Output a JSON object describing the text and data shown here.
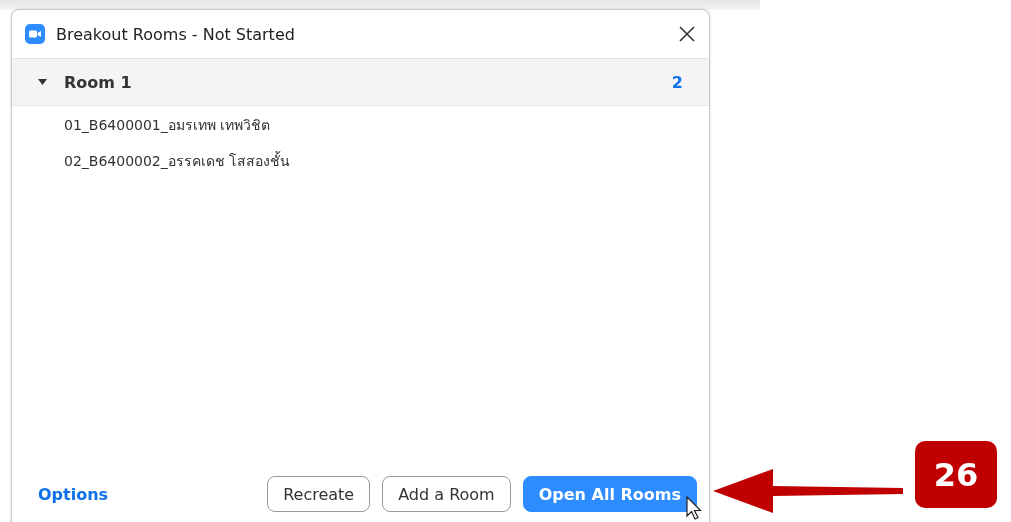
{
  "window": {
    "title": "Breakout Rooms - Not Started"
  },
  "rooms": [
    {
      "name": "Room 1",
      "count": "2",
      "expanded": true,
      "members": [
        "01_B6400001_อมรเทพ เทพวิชิต",
        "02_B6400002_อรรคเดช โสสองชั้น"
      ]
    }
  ],
  "footer": {
    "options_link": "Options",
    "buttons": [
      {
        "label": "Recreate",
        "kind": "secondary"
      },
      {
        "label": "Add a Room",
        "kind": "secondary"
      },
      {
        "label": "Open All Rooms",
        "kind": "primary"
      }
    ]
  },
  "callout": {
    "number": "26"
  }
}
